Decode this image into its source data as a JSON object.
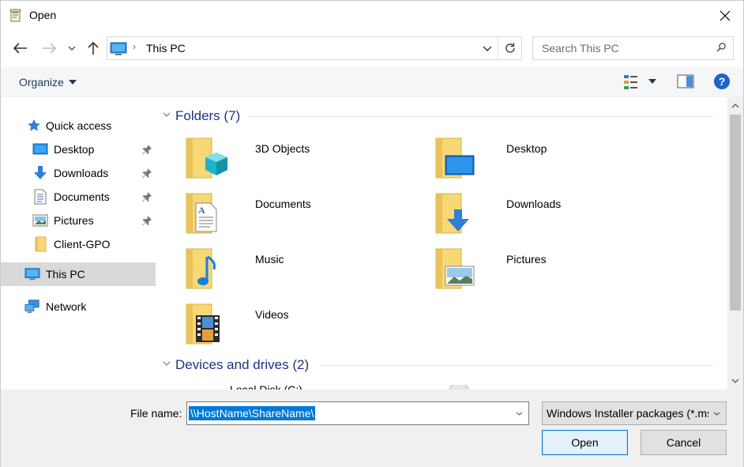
{
  "window": {
    "title": "Open"
  },
  "address": {
    "location": "This PC"
  },
  "search": {
    "placeholder": "Search This PC"
  },
  "toolbar": {
    "organize_label": "Organize"
  },
  "sidebar": {
    "items": [
      {
        "label": "Quick access",
        "icon": "star-icon",
        "pinned": false
      },
      {
        "label": "Desktop",
        "icon": "desktop-icon",
        "pinned": true
      },
      {
        "label": "Downloads",
        "icon": "download-arrow-icon",
        "pinned": true
      },
      {
        "label": "Documents",
        "icon": "document-icon",
        "pinned": true
      },
      {
        "label": "Pictures",
        "icon": "pictures-icon",
        "pinned": true
      },
      {
        "label": "Client-GPO",
        "icon": "folder-icon",
        "pinned": false
      },
      {
        "label": "This PC",
        "icon": "computer-icon",
        "selected": true
      },
      {
        "label": "Network",
        "icon": "network-icon"
      }
    ]
  },
  "groups": {
    "folders": {
      "title": "Folders (7)",
      "items": [
        "3D Objects",
        "Desktop",
        "Documents",
        "Downloads",
        "Music",
        "Pictures",
        "Videos"
      ]
    },
    "drives": {
      "title": "Devices and drives (2)",
      "items": [
        "Local Disk (C:)"
      ]
    }
  },
  "footer": {
    "filename_label": "File name:",
    "filename_value": "\\\\HostName\\ShareName\\",
    "filetype_value": "Windows Installer packages (*.msi)",
    "open_label": "Open",
    "cancel_label": "Cancel"
  },
  "colors": {
    "accent": "#0078d7",
    "group_title": "#1e3287",
    "folder_yellow": "#f8d775",
    "selection_bg": "#d9d9d9"
  }
}
